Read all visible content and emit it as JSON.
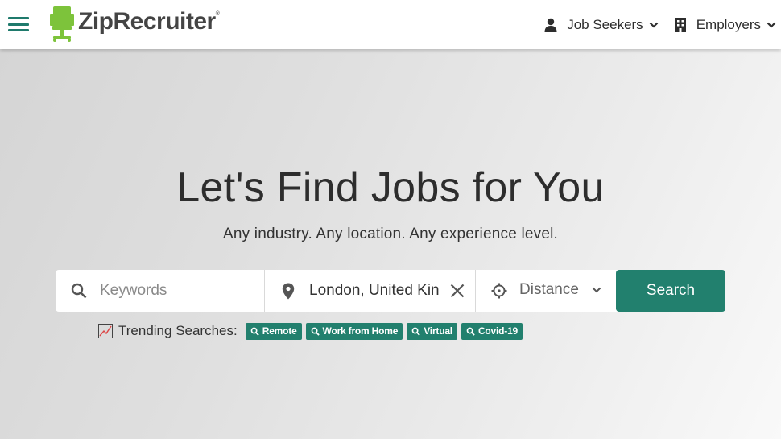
{
  "header": {
    "brand": "ZipRecruiter",
    "brand_mark": "®",
    "nav": [
      {
        "label": "Job Seekers",
        "icon": "person-icon"
      },
      {
        "label": "Employers",
        "icon": "building-icon"
      }
    ]
  },
  "hero": {
    "title": "Let's Find Jobs for You",
    "subtitle": "Any industry. Any location. Any experience level."
  },
  "search": {
    "keywords_placeholder": "Keywords",
    "location_value": "London, United Kin",
    "distance_label": "Distance",
    "button_label": "Search"
  },
  "trending": {
    "label": "Trending Searches:",
    "items": [
      "Remote",
      "Work from Home",
      "Virtual",
      "Covid-19"
    ]
  },
  "colors": {
    "brand_green": "#22806e",
    "logo_green": "#7dc33b",
    "text": "#2d2d2d"
  }
}
